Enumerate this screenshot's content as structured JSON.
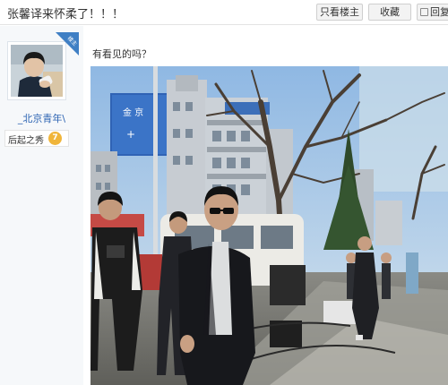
{
  "post": {
    "title": "张馨译来怀柔了！！！",
    "content": "有看见的吗？"
  },
  "toolbar": {
    "only_op_label": "只看楼主",
    "favorite_label": "收藏",
    "reply_label": "回复"
  },
  "author": {
    "username": "_北京青年\\",
    "level_name": "后起之秀",
    "level_number": "7"
  },
  "icons": {
    "reply": "reply-icon",
    "level": "level-badge-icon",
    "op": "op-corner-badge"
  },
  "colors": {
    "link": "#2d64b3",
    "badge_blue": "#3f7fc4",
    "level_badge": "#f0b53a"
  }
}
